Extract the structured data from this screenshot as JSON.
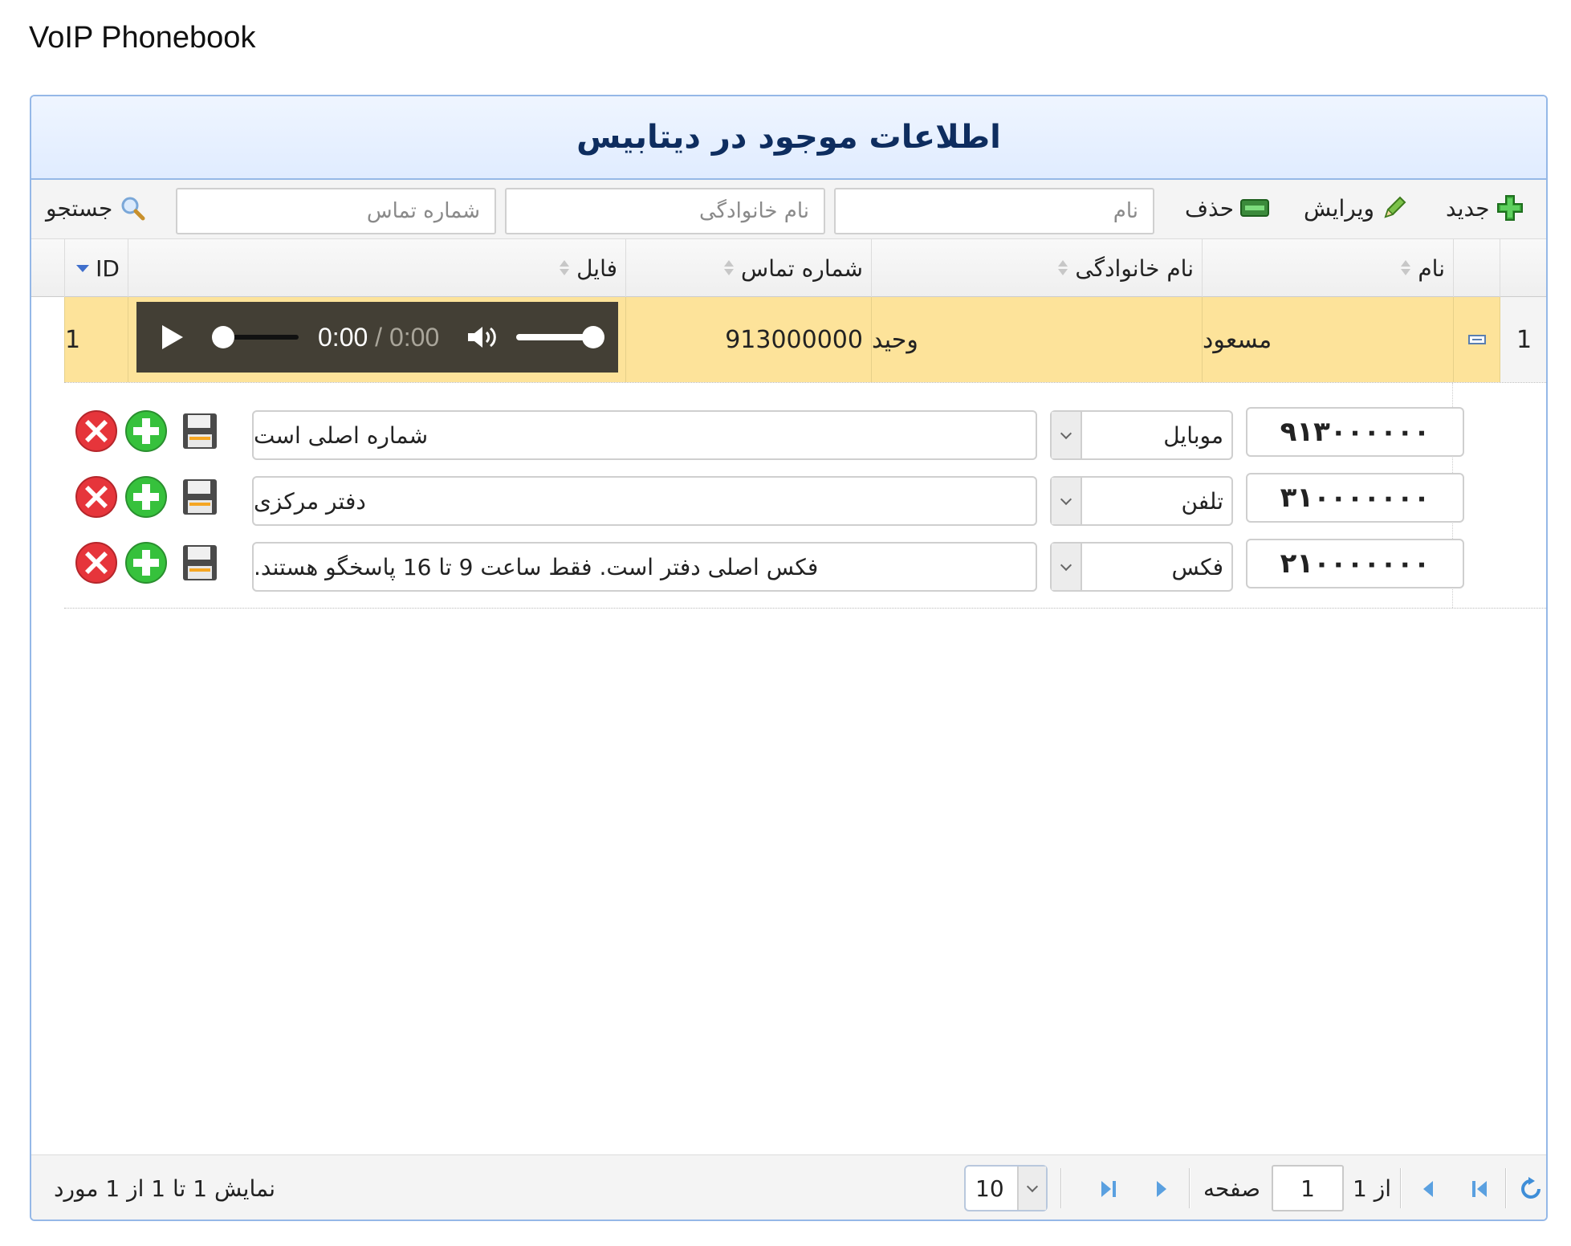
{
  "app_title": "VoIP Phonebook",
  "panel_title": "اطلاعات موجود در دیتابیس",
  "toolbar": {
    "new_label": "جدید",
    "edit_label": "ویرایش",
    "delete_label": "حذف",
    "search_label": "جستجو",
    "first_name_placeholder": "نام",
    "last_name_placeholder": "نام خانوادگی",
    "phone_placeholder": "شماره تماس"
  },
  "columns": {
    "id": "ID",
    "file": "فایل",
    "phone": "شماره تماس",
    "last_name": "نام خانوادگی",
    "first_name": "نام"
  },
  "rows": [
    {
      "row_number": "1",
      "first_name": "مسعود",
      "last_name": "وحید",
      "phone": "913000000",
      "id": "1",
      "player": {
        "current_time": "0:00",
        "separator": "/",
        "duration": "0:00",
        "volume_fraction": 1.0,
        "progress_fraction": 0.0
      }
    }
  ],
  "detail_numbers": [
    {
      "number": "۹۱۳۰۰۰۰۰۰",
      "type": "موبایل",
      "description": "شماره اصلی است"
    },
    {
      "number": "۳۱۰۰۰۰۰۰۰",
      "type": "تلفن",
      "description": "دفتر مرکزی"
    },
    {
      "number": "۲۱۰۰۰۰۰۰۰",
      "type": "فکس",
      "description": "فکس اصلی دفتر است. فقط ساعت 9 تا 16 پاسخگو هستند."
    }
  ],
  "pager": {
    "page_label": "صفحه",
    "page_value": "1",
    "of_label": "از 1",
    "page_size": "10",
    "summary": "نمایش 1 تا 1 از 1 مورد"
  },
  "colors": {
    "header_border": "#95b8e7",
    "selected_row": "#fde39a",
    "title_text": "#0e2d5f",
    "pager_icon": "#3f8ed8"
  },
  "icons": [
    "plus-icon",
    "pencil-icon",
    "minus-icon",
    "search-icon",
    "sort-icon",
    "play-icon",
    "volume-icon",
    "delete-icon",
    "add-icon",
    "save-icon",
    "first-page-icon",
    "prev-page-icon",
    "next-page-icon",
    "last-page-icon",
    "refresh-icon"
  ]
}
